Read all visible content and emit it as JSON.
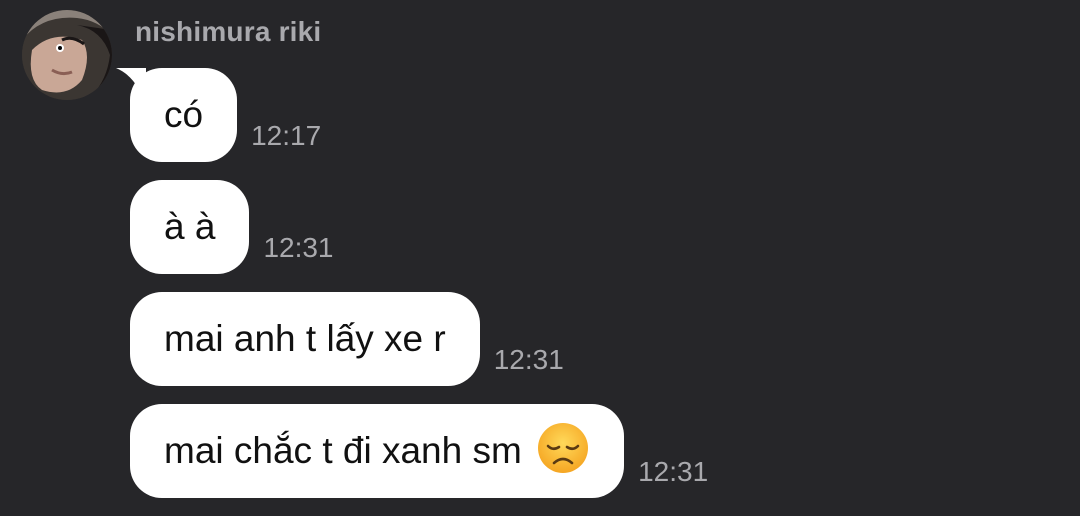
{
  "sender": {
    "name": "nishimura riki"
  },
  "messages": [
    {
      "text": "có",
      "time": "12:17"
    },
    {
      "text": "à à",
      "time": "12:31"
    },
    {
      "text": "mai anh t lấy xe r",
      "time": "12:31"
    },
    {
      "text": "mai chắc t đi xanh sm",
      "emoji": "disappointed-face-emoji",
      "time": "12:31"
    }
  ],
  "colors": {
    "background": "#262629",
    "bubble": "#ffffff",
    "muted_text": "#a9a9ad"
  }
}
